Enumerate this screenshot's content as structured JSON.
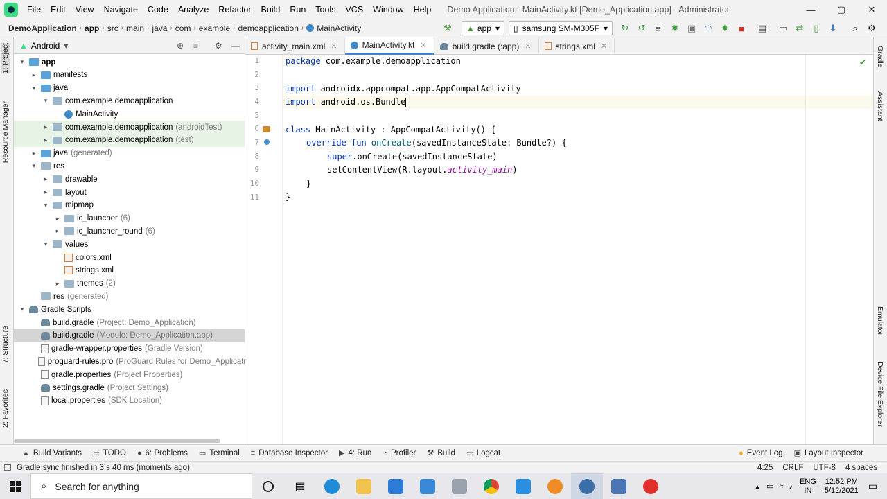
{
  "menu": {
    "items": [
      "File",
      "Edit",
      "View",
      "Navigate",
      "Code",
      "Analyze",
      "Refactor",
      "Build",
      "Run",
      "Tools",
      "VCS",
      "Window",
      "Help"
    ],
    "window_title": "Demo Application - MainActivity.kt [Demo_Application.app] - Administrator"
  },
  "breadcrumb": [
    "DemoApplication",
    "app",
    "src",
    "main",
    "java",
    "com",
    "example",
    "demoapplication",
    "MainActivity"
  ],
  "toolbar": {
    "config": "app",
    "device": "samsung SM-M305F"
  },
  "project": {
    "view": "Android",
    "tree": [
      {
        "label": "app",
        "muted": "",
        "depth": 0,
        "arrow": "▾",
        "icon": "folder-blue",
        "bold": true
      },
      {
        "label": "manifests",
        "muted": "",
        "depth": 1,
        "arrow": "▸",
        "icon": "folder-blue"
      },
      {
        "label": "java",
        "muted": "",
        "depth": 1,
        "arrow": "▾",
        "icon": "folder-blue"
      },
      {
        "label": "com.example.demoapplication",
        "muted": "",
        "depth": 2,
        "arrow": "▾",
        "icon": "folder"
      },
      {
        "label": "MainActivity",
        "muted": "",
        "depth": 3,
        "arrow": "",
        "icon": "kotlin"
      },
      {
        "label": "com.example.demoapplication",
        "muted": "(androidTest)",
        "depth": 2,
        "arrow": "▸",
        "icon": "folder",
        "hl": "green"
      },
      {
        "label": "com.example.demoapplication",
        "muted": "(test)",
        "depth": 2,
        "arrow": "▸",
        "icon": "folder",
        "hl": "green"
      },
      {
        "label": "java",
        "muted": "(generated)",
        "depth": 1,
        "arrow": "▸",
        "icon": "folder-blue"
      },
      {
        "label": "res",
        "muted": "",
        "depth": 1,
        "arrow": "▾",
        "icon": "folder"
      },
      {
        "label": "drawable",
        "muted": "",
        "depth": 2,
        "arrow": "▸",
        "icon": "folder"
      },
      {
        "label": "layout",
        "muted": "",
        "depth": 2,
        "arrow": "▸",
        "icon": "folder"
      },
      {
        "label": "mipmap",
        "muted": "",
        "depth": 2,
        "arrow": "▾",
        "icon": "folder"
      },
      {
        "label": "ic_launcher",
        "muted": "(6)",
        "depth": 3,
        "arrow": "▸",
        "icon": "folder"
      },
      {
        "label": "ic_launcher_round",
        "muted": "(6)",
        "depth": 3,
        "arrow": "▸",
        "icon": "folder"
      },
      {
        "label": "values",
        "muted": "",
        "depth": 2,
        "arrow": "▾",
        "icon": "folder"
      },
      {
        "label": "colors.xml",
        "muted": "",
        "depth": 3,
        "arrow": "",
        "icon": "xml"
      },
      {
        "label": "strings.xml",
        "muted": "",
        "depth": 3,
        "arrow": "",
        "icon": "xml"
      },
      {
        "label": "themes",
        "muted": "(2)",
        "depth": 3,
        "arrow": "▸",
        "icon": "folder"
      },
      {
        "label": "res",
        "muted": "(generated)",
        "depth": 1,
        "arrow": "",
        "icon": "folder"
      },
      {
        "label": "Gradle Scripts",
        "muted": "",
        "depth": 0,
        "arrow": "▾",
        "icon": "gradle"
      },
      {
        "label": "build.gradle",
        "muted": "(Project: Demo_Application)",
        "depth": 1,
        "arrow": "",
        "icon": "gradle"
      },
      {
        "label": "build.gradle",
        "muted": "(Module: Demo_Application.app)",
        "depth": 1,
        "arrow": "",
        "icon": "gradle",
        "hl": "sel"
      },
      {
        "label": "gradle-wrapper.properties",
        "muted": "(Gradle Version)",
        "depth": 1,
        "arrow": "",
        "icon": "props"
      },
      {
        "label": "proguard-rules.pro",
        "muted": "(ProGuard Rules for Demo_Applicati",
        "depth": 1,
        "arrow": "",
        "icon": "file"
      },
      {
        "label": "gradle.properties",
        "muted": "(Project Properties)",
        "depth": 1,
        "arrow": "",
        "icon": "props"
      },
      {
        "label": "settings.gradle",
        "muted": "(Project Settings)",
        "depth": 1,
        "arrow": "",
        "icon": "gradle"
      },
      {
        "label": "local.properties",
        "muted": "(SDK Location)",
        "depth": 1,
        "arrow": "",
        "icon": "props"
      }
    ]
  },
  "left_tabs": {
    "project": "1: Project",
    "resource": "Resource Manager",
    "structure": "7: Structure",
    "favorites": "2: Favorites"
  },
  "right_tabs": {
    "gradle": "Gradle",
    "assistant": "Assistant",
    "emulator": "Emulator",
    "device": "Device File Explorer"
  },
  "editor_tabs": [
    {
      "label": "activity_main.xml",
      "icon": "xml"
    },
    {
      "label": "MainActivity.kt",
      "icon": "kotlin",
      "active": true
    },
    {
      "label": "build.gradle (:app)",
      "icon": "gradle"
    },
    {
      "label": "strings.xml",
      "icon": "xml"
    }
  ],
  "code": {
    "line_numbers": [
      "1",
      "2",
      "3",
      "4",
      "5",
      "6",
      "7",
      "8",
      "9",
      "10",
      "11"
    ],
    "l1_kw": "package",
    "l1_rest": " com.example.demoapplication",
    "l3_kw": "import",
    "l3_rest": " androidx.appcompat.app.AppCompatActivity",
    "l4_kw": "import",
    "l4_rest": " android.os.Bundle",
    "l6_kw": "class",
    "l6_rest": " MainActivity : AppCompatActivity() {",
    "l7_kw1": "override",
    "l7_kw2": " fun ",
    "l7_fn": "onCreate",
    "l7_rest": "(savedInstanceState: Bundle?) {",
    "l8_kw": "super",
    "l8_rest": ".onCreate(savedInstanceState)",
    "l9_a": "setContentView(R.layout.",
    "l9_it": "activity_main",
    "l9_b": ")",
    "l10": "}",
    "l11": "}"
  },
  "bottom_tabs": [
    {
      "label": "Build Variants",
      "icon": "▲"
    },
    {
      "label": "TODO",
      "icon": "☰"
    },
    {
      "label": "6: Problems",
      "icon": "●"
    },
    {
      "label": "Terminal",
      "icon": "▭"
    },
    {
      "label": "Database Inspector",
      "icon": "≡"
    },
    {
      "label": "4: Run",
      "icon": "▶"
    },
    {
      "label": "Profiler",
      "icon": "◔"
    },
    {
      "label": "Build",
      "icon": "⚒"
    },
    {
      "label": "Logcat",
      "icon": "☰"
    }
  ],
  "bottom_right_tabs": [
    {
      "label": "Event Log",
      "icon": "●"
    },
    {
      "label": "Layout Inspector",
      "icon": "▣"
    }
  ],
  "status": {
    "message": "Gradle sync finished in 3 s 40 ms (moments ago)",
    "position": "4:25",
    "line_sep": "CRLF",
    "encoding": "UTF-8",
    "indent": "4 spaces"
  },
  "taskbar": {
    "search_placeholder": "Search for anything",
    "lang": "ENG",
    "region": "IN",
    "time": "12:52 PM",
    "date": "5/12/2021"
  },
  "colors": {
    "accent": "#4083c9",
    "keyword": "#0033b3",
    "italic": "#871094"
  }
}
